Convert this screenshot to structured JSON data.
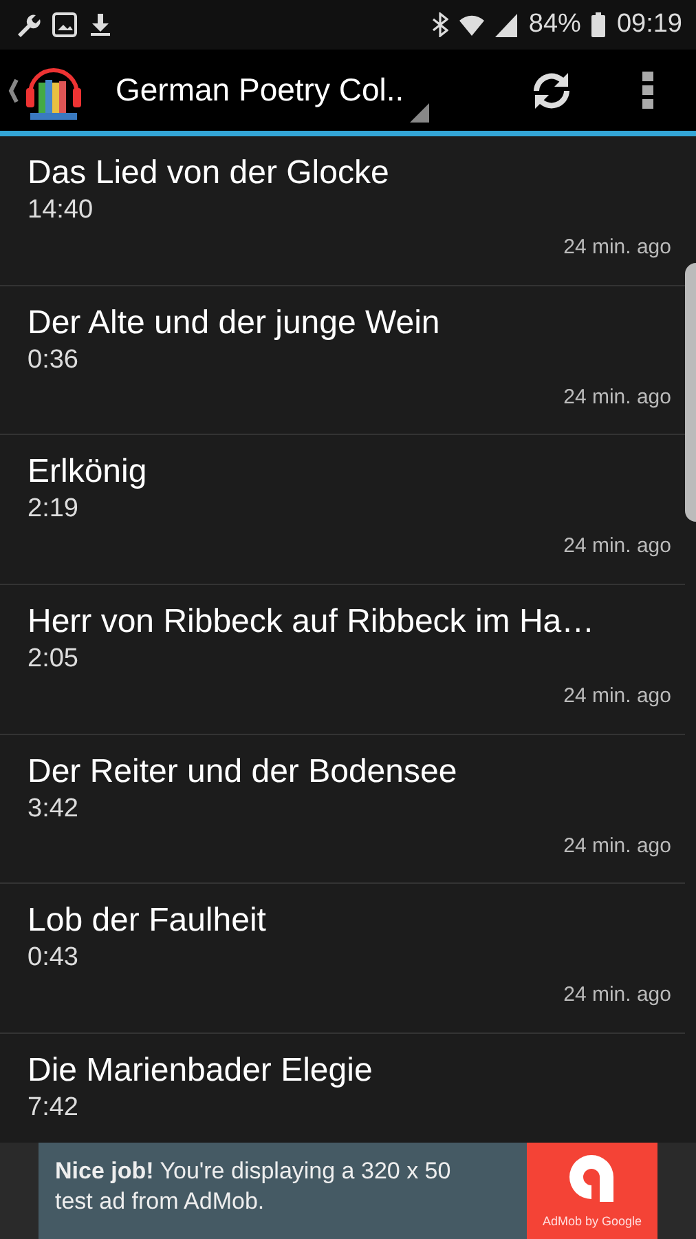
{
  "status_bar": {
    "battery": "84%",
    "time": "09:19"
  },
  "app_bar": {
    "title": "German Poetry Col.."
  },
  "poems": [
    {
      "title": "Das Lied von der Glocke",
      "duration": "14:40",
      "ago": "24 min. ago"
    },
    {
      "title": "Der Alte und der junge Wein",
      "duration": "0:36",
      "ago": "24 min. ago"
    },
    {
      "title": "Erlkönig",
      "duration": "2:19",
      "ago": "24 min. ago"
    },
    {
      "title": "Herr von Ribbeck auf Ribbeck im Ha…",
      "duration": "2:05",
      "ago": "24 min. ago"
    },
    {
      "title": "Der Reiter und der Bodensee",
      "duration": "3:42",
      "ago": "24 min. ago"
    },
    {
      "title": "Lob der Faulheit",
      "duration": "0:43",
      "ago": "24 min. ago"
    },
    {
      "title": "Die Marienbader Elegie",
      "duration": "7:42"
    }
  ],
  "ad": {
    "text": "**Nice job!** You're displaying a 320 x 50 test ad from AdMob.",
    "brand": "AdMob by Google"
  }
}
